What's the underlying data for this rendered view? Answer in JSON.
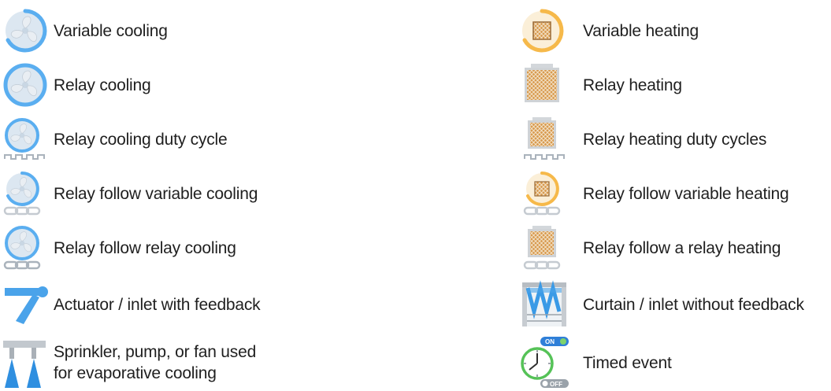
{
  "legend": {
    "cooling": [
      {
        "label": "Variable cooling",
        "icon": "variable-cooling-fan-icon"
      },
      {
        "label": "Relay cooling",
        "icon": "relay-cooling-fan-icon"
      },
      {
        "label": "Relay cooling duty cycle",
        "icon": "relay-cooling-duty-cycle-icon"
      },
      {
        "label": "Relay follow variable cooling",
        "icon": "relay-follow-variable-cooling-icon"
      },
      {
        "label": "Relay follow relay cooling",
        "icon": "relay-follow-relay-cooling-icon"
      },
      {
        "label": "Actuator / inlet with feedback",
        "icon": "actuator-inlet-icon"
      },
      {
        "label_line1": "Sprinkler, pump, or fan used",
        "label_line2": "for evaporative cooling",
        "icon": "sprinkler-icon"
      }
    ],
    "heating": [
      {
        "label": "Variable heating",
        "icon": "variable-heating-icon"
      },
      {
        "label": "Relay heating",
        "icon": "relay-heating-icon"
      },
      {
        "label": "Relay heating duty cycles",
        "icon": "relay-heating-duty-cycle-icon"
      },
      {
        "label": "Relay follow variable heating",
        "icon": "relay-follow-variable-heating-icon"
      },
      {
        "label": "Relay follow a relay heating",
        "icon": "relay-follow-relay-heating-icon"
      },
      {
        "label": "Curtain / inlet without feedback",
        "icon": "curtain-inlet-icon"
      },
      {
        "label": "Timed event",
        "icon": "timed-event-icon",
        "badge_on": "ON",
        "badge_off": "OFF"
      }
    ]
  },
  "colors": {
    "fan_blue": "#5aaef0",
    "fan_light": "#d7e6f3",
    "heat_orange": "#f6b94a",
    "heater_copper": "#c9843a",
    "gray": "#b9bfc5",
    "spray_blue": "#2f8fe0",
    "clock_green": "#55c257"
  }
}
